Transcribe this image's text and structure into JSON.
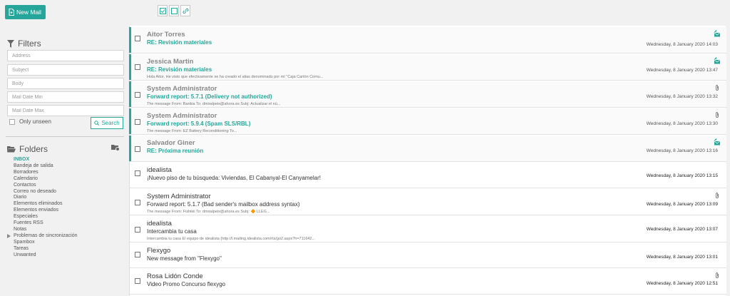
{
  "toolbar": {
    "new_mail_label": "New Mail"
  },
  "filters": {
    "title": "Filters",
    "address_placeholder": "Address",
    "subject_placeholder": "Subject",
    "body_placeholder": "Body",
    "date_min_placeholder": "Mail Date Min",
    "date_max_placeholder": "Mail Date Max",
    "only_unseen_label": "Only unseen",
    "search_label": "Search"
  },
  "folders": {
    "title": "Folders",
    "items": [
      {
        "label": "INBOX",
        "active": true
      },
      {
        "label": "Bandeja de salida"
      },
      {
        "label": "Borradores"
      },
      {
        "label": "Calendario"
      },
      {
        "label": "Contactos"
      },
      {
        "label": "Correo no deseado"
      },
      {
        "label": "Diario"
      },
      {
        "label": "Elementos eliminados"
      },
      {
        "label": "Elementos enviados"
      },
      {
        "label": "Especiales"
      },
      {
        "label": "Fuentes RSS"
      },
      {
        "label": "Notas"
      },
      {
        "label": "Problemas de sincronización",
        "has_children": true
      },
      {
        "label": "Spambox"
      },
      {
        "label": "Tareas"
      },
      {
        "label": "Unwanted"
      }
    ]
  },
  "emails": [
    {
      "sender": "Aitor Torres",
      "subject": "RE: Revisión materiales",
      "preview": "",
      "date": "Wednesday, 8 January 2020 14:03",
      "unread": true,
      "icon": "reply-mail-icon"
    },
    {
      "sender": "Jessica Martin",
      "subject": "RE: Revisión materiales",
      "preview": "Hola Aitor, He visto que efectivamente se ha creado el alias denominado por mí \"Caja Cartón Comu...",
      "date": "Wednesday, 8 January 2020 13:47",
      "unread": true,
      "icon": "reply-mail-icon"
    },
    {
      "sender": "System Administrator",
      "subject": "Forward report: 5.7.1 (Delivery not authorized)",
      "preview": "The message From: Bankia To: dmiralpeix@ahora.es Subj: Actualizar el nú...",
      "date": "Wednesday, 8 January 2020 13:32",
      "unread": true,
      "icon": "paperclip-icon"
    },
    {
      "sender": "System Administrator",
      "subject": "Forward report: 5.9.4 (Spam SLS/RBL)",
      "preview": "The message From: EZ Battery Reconditioning To...",
      "date": "Wednesday, 8 January 2020 13:30",
      "unread": true,
      "icon": "paperclip-icon"
    },
    {
      "sender": "Salvador Giner",
      "subject": "RE: Próxima reunión",
      "preview": "",
      "date": "Wednesday, 8 January 2020 13:16",
      "unread": true,
      "icon": "reply-mail-icon"
    },
    {
      "sender": "idealista",
      "subject": "¡Nuevo piso de tu búsqueda: Viviendas, El Cabanyal-El Canyamelar!",
      "preview": "",
      "date": "Wednesday, 8 January 2020 13:15",
      "unread": false,
      "icon": ""
    },
    {
      "sender": "System Administrator",
      "subject": "Forward report: 5.1.7 (Bad sender's mailbox address syntax)",
      "preview": "The message From: Fishikii To: dmiralpeix@ahora.es Subj: 🔶 LLEG...",
      "date": "Wednesday, 8 January 2020 13:09",
      "unread": false,
      "icon": "paperclip-icon"
    },
    {
      "sender": "idealista",
      "subject": "Intercambia tu casa",
      "preview": "Intercambia tu casa El equipo de idealista   (http://l.mailing.idealista.com/rts/go2.aspx?h=711642...",
      "date": "Wednesday, 8 January 2020 13:07",
      "unread": false,
      "icon": ""
    },
    {
      "sender": "Flexygo",
      "subject": "New message from \"Flexygo\"",
      "preview": "",
      "date": "Wednesday, 8 January 2020 13:01",
      "unread": false,
      "icon": ""
    },
    {
      "sender": "Rosa Lidón Conde",
      "subject": "Video Promo Concurso flexygo",
      "preview": "",
      "date": "Wednesday, 8 January 2020 12:51",
      "unread": false,
      "icon": "paperclip-icon"
    }
  ],
  "colors": {
    "accent": "#26a69a",
    "background": "#f1f1f1"
  }
}
